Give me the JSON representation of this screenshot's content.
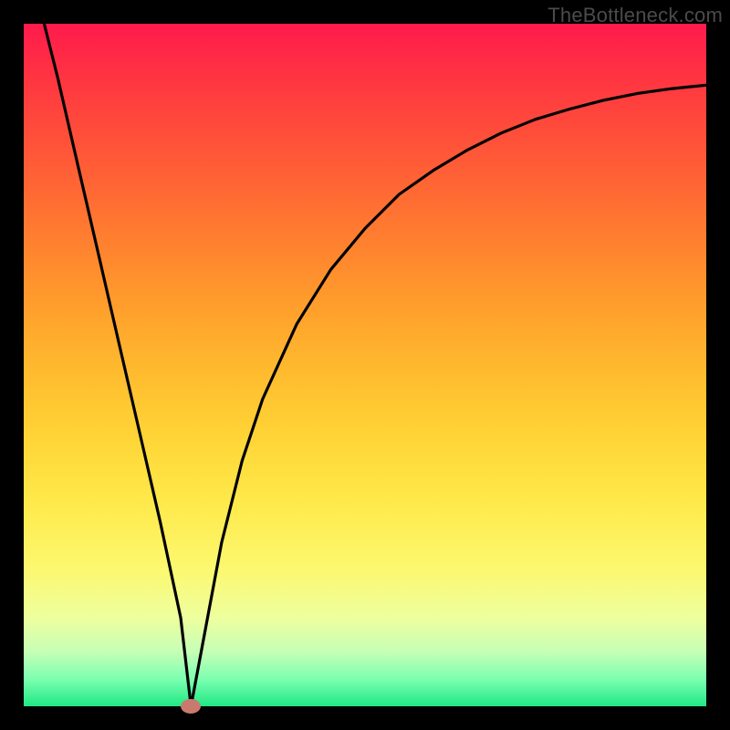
{
  "domain": "Chart",
  "watermark": "TheBottleneck.com",
  "chart_data": {
    "type": "line",
    "title": "",
    "xlabel": "",
    "ylabel": "",
    "xlim": [
      0,
      100
    ],
    "ylim": [
      0,
      100
    ],
    "grid": false,
    "note": "Data estimated from pixels. y: 100=top (red) → 0=bottom (green). Curve shows a V-shaped minimum where bottleneck is zero.",
    "series": [
      {
        "name": "bottleneck-curve",
        "x": [
          3,
          5,
          8,
          11,
          14,
          17,
          20,
          23,
          24.5,
          26,
          29,
          32,
          35,
          40,
          45,
          50,
          55,
          60,
          65,
          70,
          75,
          80,
          85,
          90,
          95,
          100
        ],
        "y": [
          100,
          92,
          79,
          66,
          53,
          40,
          27,
          13,
          0,
          8,
          24,
          36,
          45,
          56,
          64,
          70,
          75,
          78.5,
          81.5,
          84,
          86,
          87.5,
          88.8,
          89.8,
          90.5,
          91
        ]
      }
    ],
    "marker": {
      "x": 24.5,
      "y": 0
    },
    "background_gradient": {
      "top": "#ff1a4c",
      "bottom": "#20e884"
    }
  }
}
